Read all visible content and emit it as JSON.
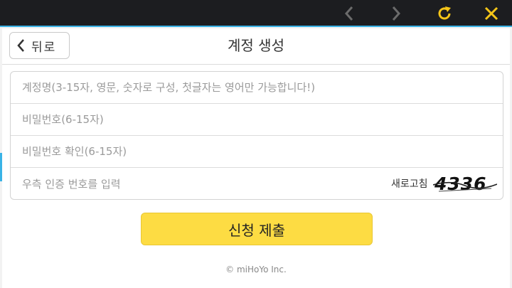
{
  "topbar": {
    "icons": {
      "back": "chevron-left-icon",
      "forward": "chevron-right-icon",
      "refresh": "refresh-icon",
      "close": "close-icon"
    },
    "colors": {
      "bar": "#1c1d20",
      "accent": "#f5c518",
      "dim": "#6b6b6b",
      "underline": "#3ab3e6"
    }
  },
  "header": {
    "back_label": "뒤로",
    "title": "계정 생성"
  },
  "form": {
    "account_placeholder": "계정명(3-15자, 영문, 숫자로 구성, 첫글자는 영어만 가능합니다!)",
    "password_placeholder": "비밀번호(6-15자)",
    "confirm_placeholder": "비밀번호 확인(6-15자)",
    "captcha_placeholder": "우측 인증 번호를 입력",
    "refresh_label": "새로고침",
    "captcha_code": "4336"
  },
  "submit_label": "신청 제출",
  "copyright": "© miHoYo Inc.",
  "colors": {
    "submit": "#fddc43"
  }
}
